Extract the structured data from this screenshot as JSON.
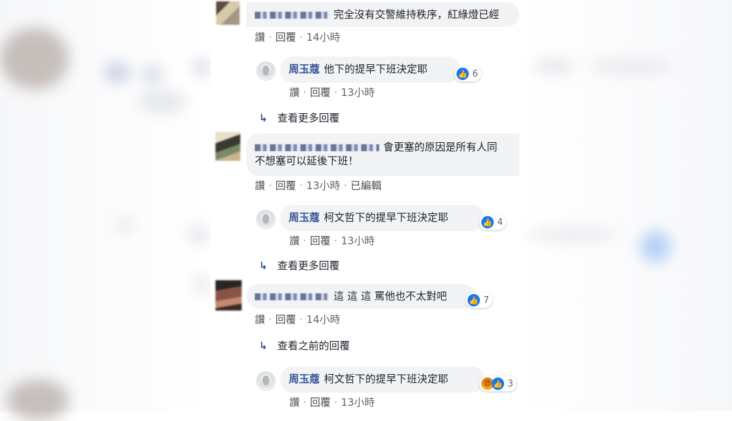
{
  "comments": [
    {
      "text": "完全沒有交警維持秩序，紅綠燈已經",
      "actions": {
        "like": "讚",
        "reply": "回覆",
        "time": "14小時"
      }
    },
    {
      "reply": {
        "name": "周玉蔻",
        "text": "他下的提早下班決定耶",
        "reactions": "6",
        "actions": {
          "like": "讚",
          "reply": "回覆",
          "time": "13小時"
        }
      }
    },
    {
      "more": "查看更多回覆"
    },
    {
      "text_line1": "會更塞的原因是所有人同",
      "text_line2": "不想塞可以延後下班！",
      "actions": {
        "like": "讚",
        "reply": "回覆",
        "time": "13小時",
        "edited": "已編輯"
      }
    },
    {
      "reply": {
        "name": "周玉蔻",
        "text": "柯文哲下的提早下班決定耶",
        "reactions": "4",
        "actions": {
          "like": "讚",
          "reply": "回覆",
          "time": "13小時"
        }
      }
    },
    {
      "more": "查看更多回覆"
    },
    {
      "text": "這 這 這 罵他也不太對吧",
      "reactions": "7",
      "actions": {
        "like": "讚",
        "reply": "回覆",
        "time": "14小時"
      }
    },
    {
      "more": "查看之前的回覆"
    },
    {
      "reply": {
        "name": "周玉蔻",
        "text": "柯文哲下的提早下班決定耶",
        "reactions": "3",
        "actions": {
          "like": "讚",
          "reply": "回覆",
          "time": "13小時"
        }
      }
    }
  ],
  "icons": {
    "like": "like-icon",
    "angry": "angry-icon",
    "reply_arrow": "reply-arrow-icon"
  },
  "colors": {
    "name_link": "#365899",
    "bubble": "#f2f3f5",
    "like_blue": "#1877f2"
  }
}
